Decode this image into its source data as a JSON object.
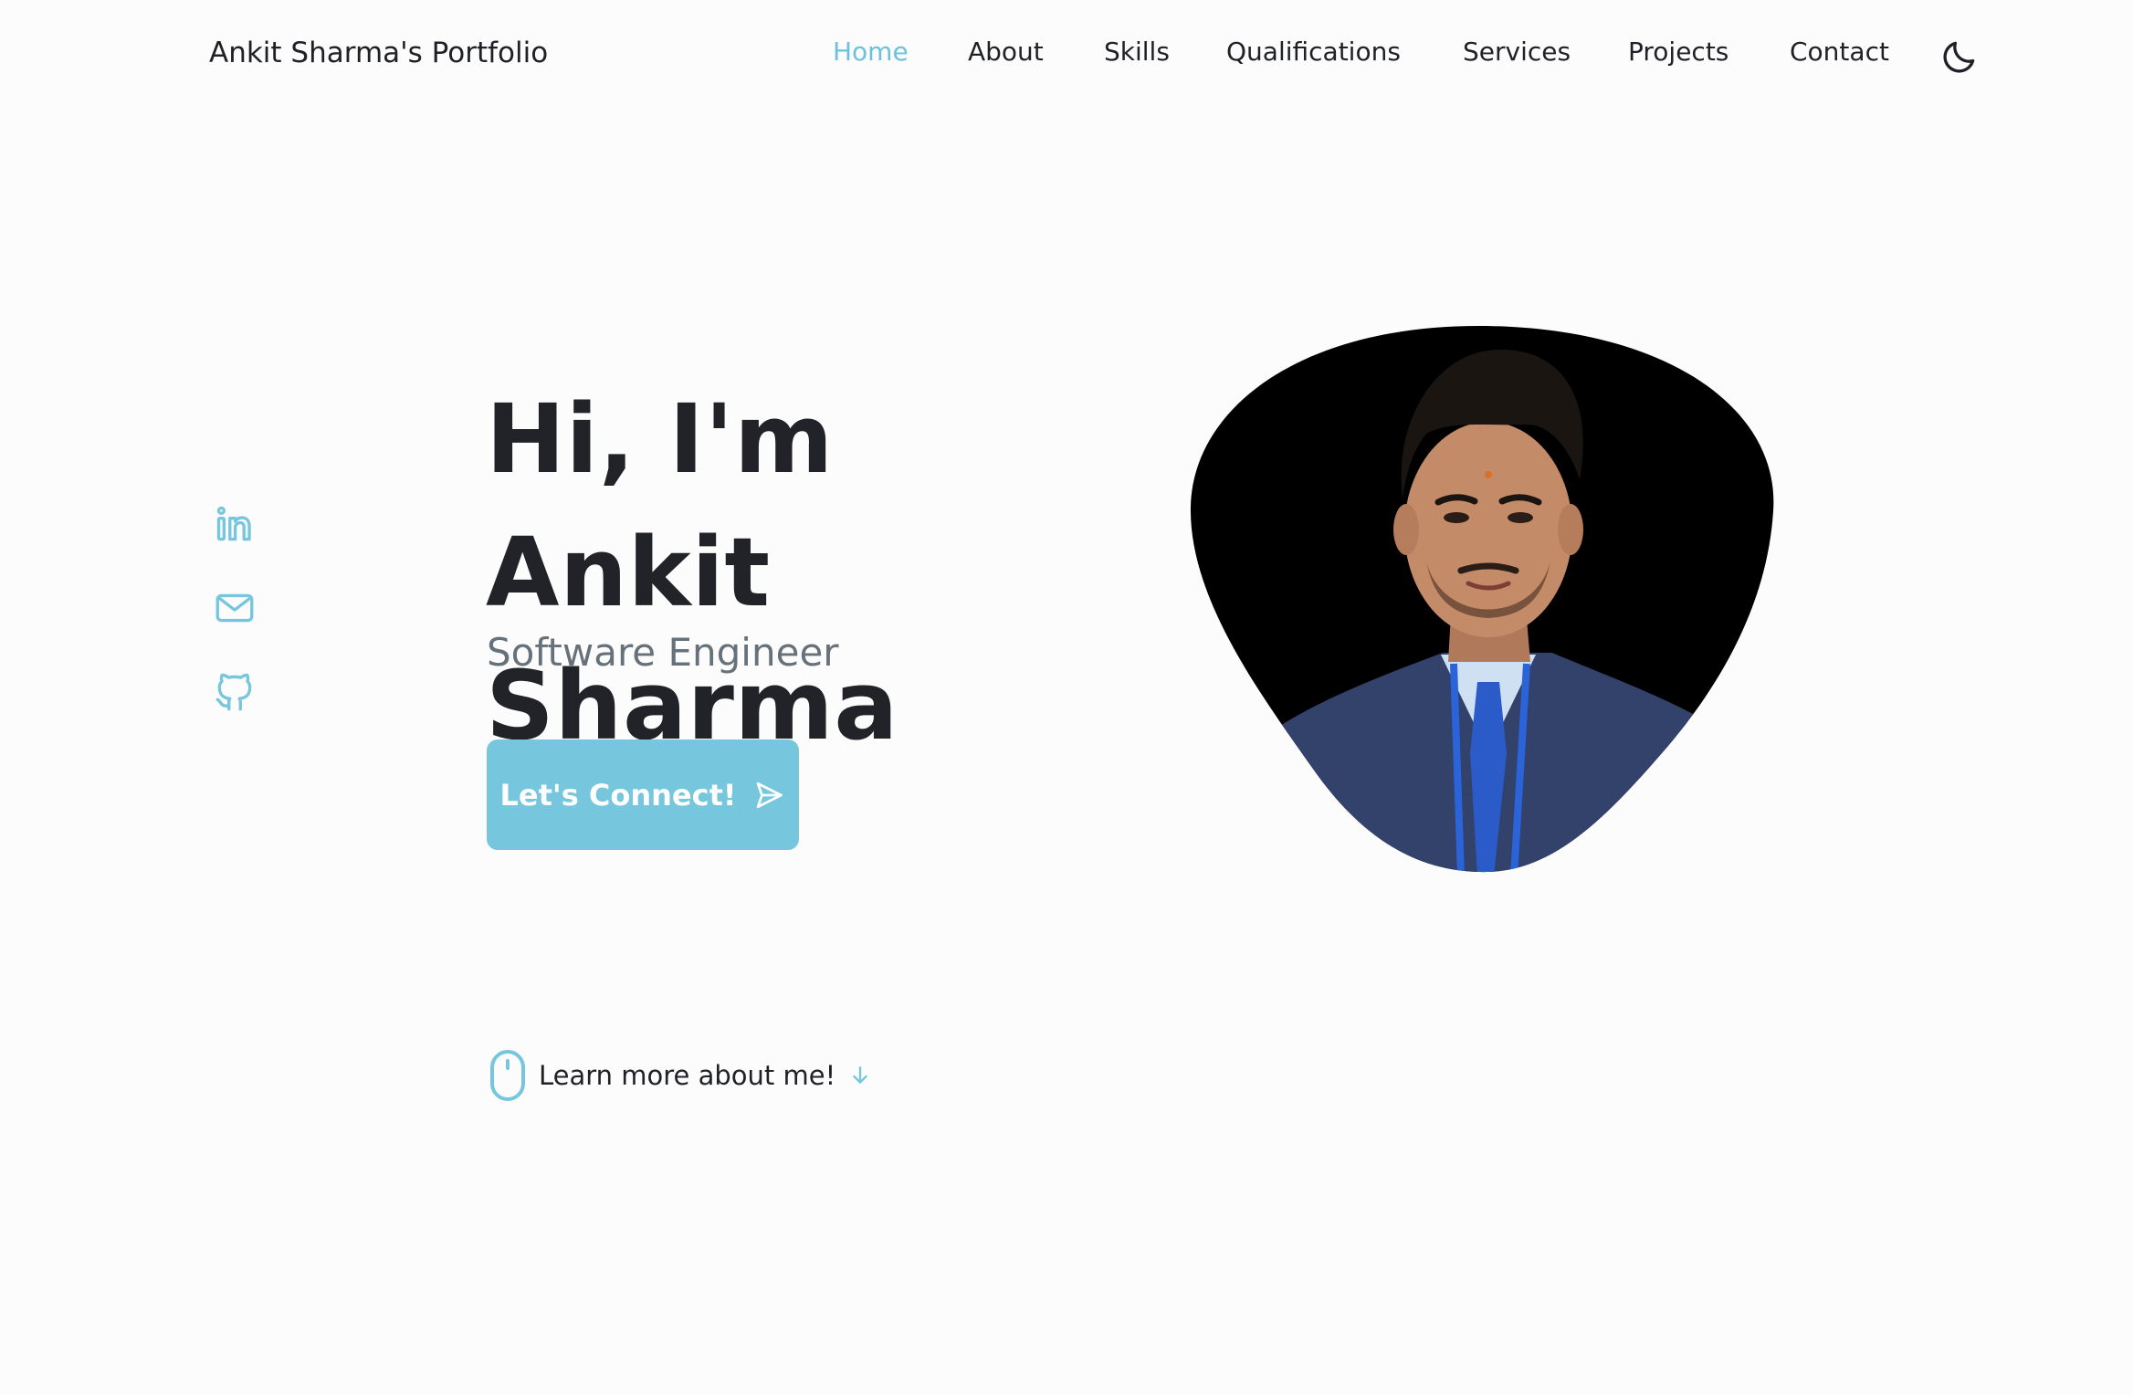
{
  "header": {
    "logo": "Ankit Sharma's Portfolio",
    "nav": [
      {
        "label": "Home",
        "active": true
      },
      {
        "label": "About",
        "active": false
      },
      {
        "label": "Skills",
        "active": false
      },
      {
        "label": "Qualifications",
        "active": false
      },
      {
        "label": "Services",
        "active": false
      },
      {
        "label": "Projects",
        "active": false
      },
      {
        "label": "Contact",
        "active": false
      }
    ],
    "theme_toggle_icon": "moon-icon"
  },
  "social": [
    {
      "icon": "linkedin-icon"
    },
    {
      "icon": "mail-icon"
    },
    {
      "icon": "github-icon"
    }
  ],
  "hero": {
    "title_line1": "Hi, I'm Ankit",
    "title_line2": "Sharma",
    "subtitle": "Software Engineer",
    "cta_label": "Let's Connect!",
    "cta_icon": "send-icon"
  },
  "scroll_hint": {
    "label": "Learn more about me!",
    "icon": "mouse-icon",
    "arrow_icon": "arrow-down-icon"
  },
  "colors": {
    "accent": "#76c6dd",
    "active_nav": "#6ec1db",
    "text_dark": "#212329",
    "text_muted": "#66717a",
    "background": "#fcfcfd"
  }
}
